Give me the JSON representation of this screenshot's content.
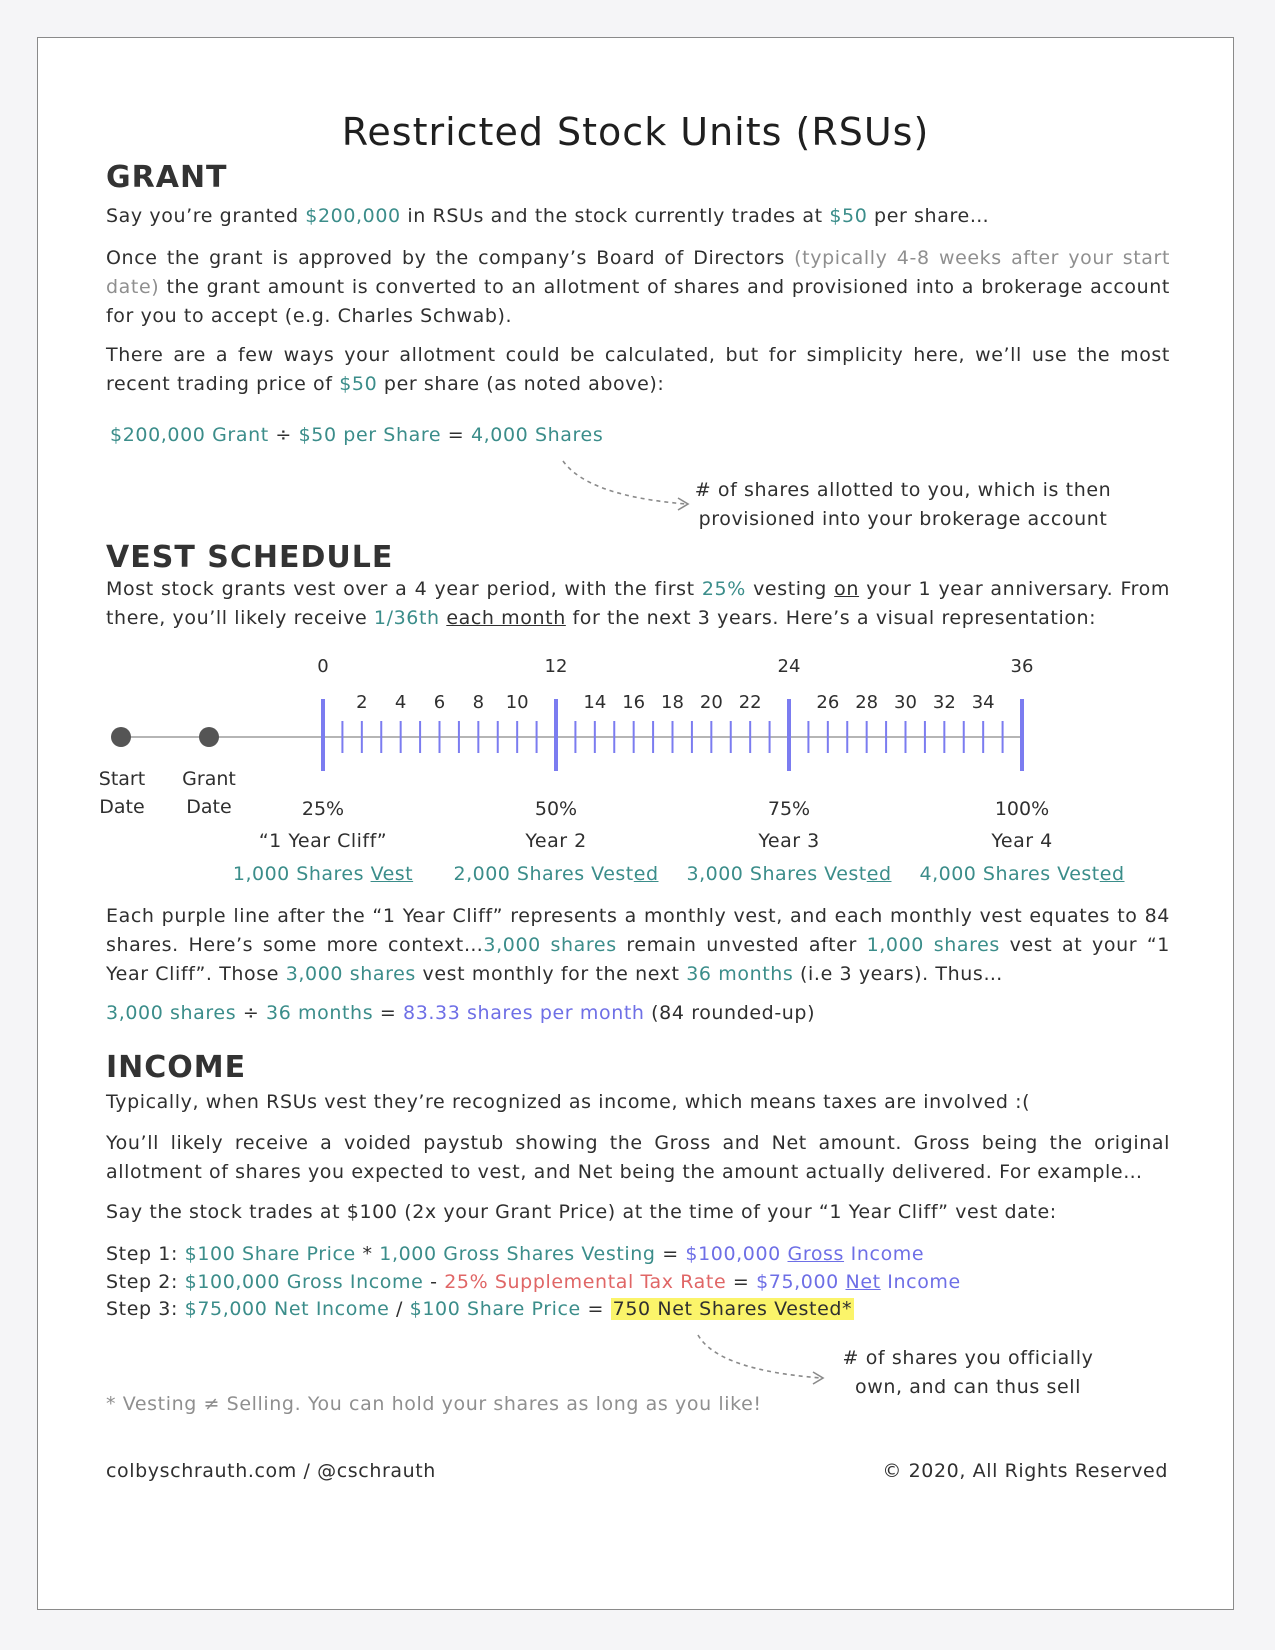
{
  "title": "Restricted Stock Units (RSUs)",
  "grant": {
    "heading": "GRANT",
    "p1": {
      "a": "Say you’re granted ",
      "amount": "$200,000",
      "b": " in RSUs and the stock currently trades at ",
      "price": "$50",
      "c": " per share…"
    },
    "p2": {
      "a": "Once the grant is approved by the company’s Board of Directors ",
      "aside": "(typically 4-8 weeks after your start date)",
      "b": " the grant amount is converted to an allotment of shares and provisioned into a brokerage account for you to accept (e.g. Charles Schwab)."
    },
    "p3": {
      "a": "There are a few ways your allotment could be calculated, but for simplicity here, we’ll use the most recent trading price of ",
      "price": "$50",
      "b": " per share (as noted above):"
    },
    "formula": {
      "grant": "$200,000 Grant",
      "div": " ÷ ",
      "per": "$50 per Share",
      "eq": " = ",
      "shares": "4,000 Shares"
    },
    "note": [
      "# of shares allotted to you, which is then",
      "provisioned into your brokerage account"
    ]
  },
  "vest": {
    "heading": "VEST SCHEDULE",
    "p1": {
      "a": "Most stock grants vest over a 4 year period, with the first ",
      "pct": "25%",
      "b": " vesting ",
      "on": "on",
      "c": " your 1 year anniversary. From there, you’ll likely receive ",
      "frac": "1/36th",
      "d": " ",
      "each": "each month",
      "e": " for the next 3 years. Here’s a visual representation:"
    },
    "timeline": {
      "major_labels": [
        "0",
        "12",
        "24",
        "36"
      ],
      "minor_labels": [
        "2",
        "4",
        "6",
        "8",
        "10",
        "14",
        "16",
        "18",
        "20",
        "22",
        "26",
        "28",
        "30",
        "32",
        "34"
      ],
      "start": [
        "Start",
        "Date"
      ],
      "grant": [
        "Grant",
        "Date"
      ],
      "milestones": [
        {
          "pct": "25%",
          "year": "“1 Year Cliff”",
          "shares": "1,000 Shares ",
          "shares_u": "Vest",
          "shares_tail": ""
        },
        {
          "pct": "50%",
          "year": "Year 2",
          "shares": "2,000 Shares Vest",
          "shares_u": "ed",
          "shares_tail": ""
        },
        {
          "pct": "75%",
          "year": "Year 3",
          "shares": "3,000 Shares Vest",
          "shares_u": "ed",
          "shares_tail": ""
        },
        {
          "pct": "100%",
          "year": "Year 4",
          "shares": "4,000 Shares Vest",
          "shares_u": "ed",
          "shares_tail": ""
        }
      ],
      "line_color": "#7b7cf0",
      "dot_color": "#555555"
    },
    "p2": {
      "a": "Each purple line after the “1 Year Cliff” represents a monthly vest, and each monthly vest equates to 84 shares. Here’s some more context…",
      "s1": "3,000 shares",
      "b": " remain unvested after ",
      "s2": "1,000 shares",
      "c": " vest at your “1 Year Cliff”. Those ",
      "s3": "3,000 shares",
      "d": " vest monthly for the next ",
      "m": "36 months",
      "e": " (i.e 3 years). Thus…"
    },
    "formula": {
      "shares": "3,000 shares",
      "div": " ÷ ",
      "months": "36 months",
      "eq": " = ",
      "result": "83.33 shares per month",
      "tail": " (84 rounded-up)"
    }
  },
  "income": {
    "heading": "INCOME",
    "p1": "Typically, when RSUs vest they’re recognized as income, which means taxes are involved :(",
    "p2": "You’ll likely receive a voided paystub showing the Gross and Net amount. Gross being the original allotment of shares you expected to vest, and Net being the amount actually delivered. For example…",
    "p3": "Say the stock trades at $100 (2x your Grant Price) at the time of your “1 Year Cliff” vest date:",
    "step1": {
      "label": "Step 1: ",
      "a": "$100 Share Price",
      "op": " * ",
      "b": "1,000 Gross Shares Vesting",
      "eq": " = ",
      "c1": "$100,000 ",
      "c2": "Gross",
      "c3": " Income"
    },
    "step2": {
      "label": "Step 2: ",
      "a": "$100,000 Gross Income",
      "op": " - ",
      "b": "25% Supplemental Tax Rate",
      "eq": " = ",
      "c1": "$75,000 ",
      "c2": "Net",
      "c3": " Income"
    },
    "step3": {
      "label": "Step 3: ",
      "a": "$75,000 Net Income",
      "op": " / ",
      "b": "$100 Share Price",
      "eq": " = ",
      "c": "750 Net Shares Vested*"
    },
    "note": [
      "# of shares you officially",
      "own, and can thus sell"
    ],
    "footnote": "* Vesting ≠ Selling. You can hold your shares as long as you like!"
  },
  "footer": {
    "left": "colbyschrauth.com / @cschrauth",
    "right": "© 2020, All Rights Reserved"
  }
}
